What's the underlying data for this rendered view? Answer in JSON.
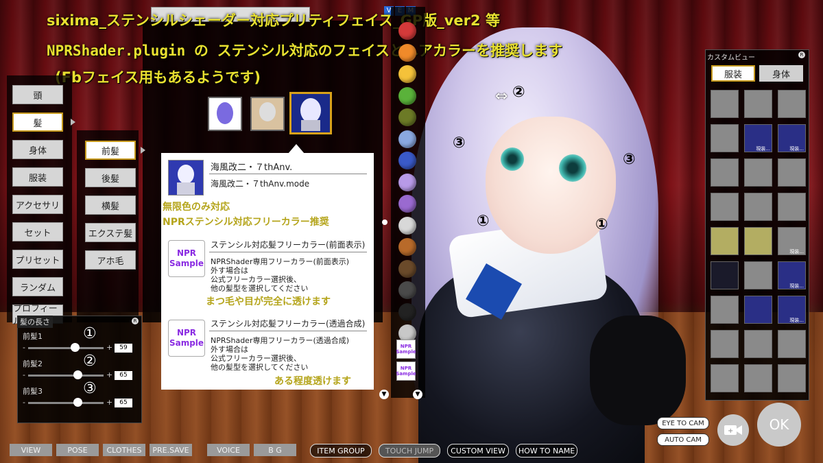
{
  "header": {
    "line1": "sixima_ステンシルシェーダー対応プリティフェイス_GP版_ver2 等",
    "line2": "NPRShader.plugin  の  ステンシル対応のフェイスとヘアカラーを推奨します",
    "line3": "(Fbフェイス用もあるようです)"
  },
  "top_badges": [
    "V",
    "E",
    "M"
  ],
  "left_menu": {
    "items": [
      "頭",
      "髪",
      "身体",
      "服装",
      "アクセサリ",
      "セット",
      "プリセット",
      "ランダム",
      "プロフィール"
    ],
    "selected": "髪"
  },
  "sub_menu": {
    "items": [
      "前髪",
      "後髪",
      "横髪",
      "エクステ髪",
      "アホ毛"
    ],
    "selected": "前髪"
  },
  "hair_length": {
    "title": "髪の長さ",
    "rows": [
      {
        "label": "前髪1",
        "value": "59",
        "marker": "①",
        "level": 0.62
      },
      {
        "label": "前髪2",
        "value": "65",
        "marker": "②",
        "level": 0.65
      },
      {
        "label": "前髪3",
        "value": "65",
        "marker": "③",
        "level": 0.65
      }
    ],
    "minus": "-",
    "plus": "+"
  },
  "popup": {
    "title": "海風改二・７thAnv.",
    "subtitle": "海風改二・７thAnv.mode",
    "note1": "無限色のみ対応",
    "note2": "NPRステンシル対応フリーカラー推奨",
    "entry1": {
      "badge_top": "NPR",
      "badge_bottom": "Sample",
      "name": "ステンシル対応髪フリーカラー(前面表示)",
      "desc": [
        "NPRShader専用フリーカラー(前面表示)",
        "外す場合は",
        "公式フリーカラー選択後、",
        "他の髪型を選択してください"
      ],
      "note": "まつ毛や目が完全に透けます"
    },
    "entry2": {
      "badge_top": "NPR",
      "badge_bottom": "Sample",
      "name": "ステンシル対応髪フリーカラー(透過合成)",
      "desc": [
        "NPRShader専用フリーカラー(透過合成)",
        "外す場合は",
        "公式フリーカラー選択後、",
        "他の髪型を選択してください"
      ],
      "note": "ある程度透けます"
    }
  },
  "color_swatches": [
    "#d43a3a",
    "#f08a2a",
    "#f5c23a",
    "#5ab23a",
    "#6c7a26",
    "#8aa8e0",
    "#3a5ac8",
    "#b89ae8",
    "#9a6ad0",
    "#d8d8d8",
    "#b86a2a",
    "#6a4a2a",
    "#4a4a4a",
    "#222222",
    "#c8c8c8"
  ],
  "color_badge": {
    "top": "NPR",
    "bottom": "Sample"
  },
  "annotations": {
    "c1": "①",
    "c2": "②",
    "c3": "③"
  },
  "custom_view": {
    "title": "カスタムビュー",
    "tabs": [
      "服装",
      "身体"
    ],
    "selected": "服装",
    "cell_label": "現装..."
  },
  "bottom_bar": {
    "left": [
      "VIEW",
      "POSE",
      "CLOTHES",
      "PRE.SAVE",
      "VOICE",
      "B G"
    ],
    "right": [
      "ITEM GROUP",
      "TOUCH JUMP",
      "CUSTOM VIEW",
      "HOW TO NAME"
    ]
  },
  "cam_buttons": [
    "EYE TO CAM",
    "AUTO CAM"
  ],
  "ok_label": "OK",
  "r_badge": "R"
}
